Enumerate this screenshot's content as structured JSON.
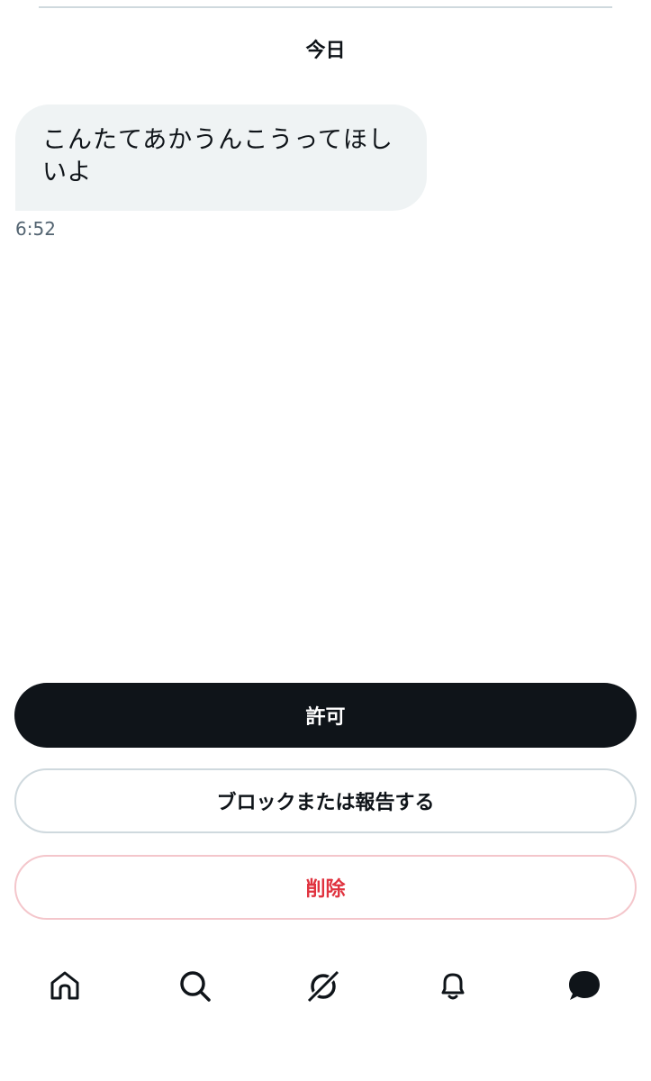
{
  "conversation": {
    "date_label": "今日",
    "message": {
      "text": "こんたてあかうんこうってほしいよ",
      "time": "6:52"
    }
  },
  "actions": {
    "allow_label": "許可",
    "block_report_label": "ブロックまたは報告する",
    "delete_label": "削除"
  },
  "bottom_nav": {
    "items": [
      {
        "icon": "home-icon"
      },
      {
        "icon": "search-icon"
      },
      {
        "icon": "grok-icon"
      },
      {
        "icon": "bell-icon"
      },
      {
        "icon": "messages-icon",
        "active": true
      }
    ]
  },
  "colors": {
    "primary_button": "#0f1419",
    "bubble_background": "#eff3f4",
    "delete_text": "#e0333f",
    "secondary_text": "#536471"
  }
}
